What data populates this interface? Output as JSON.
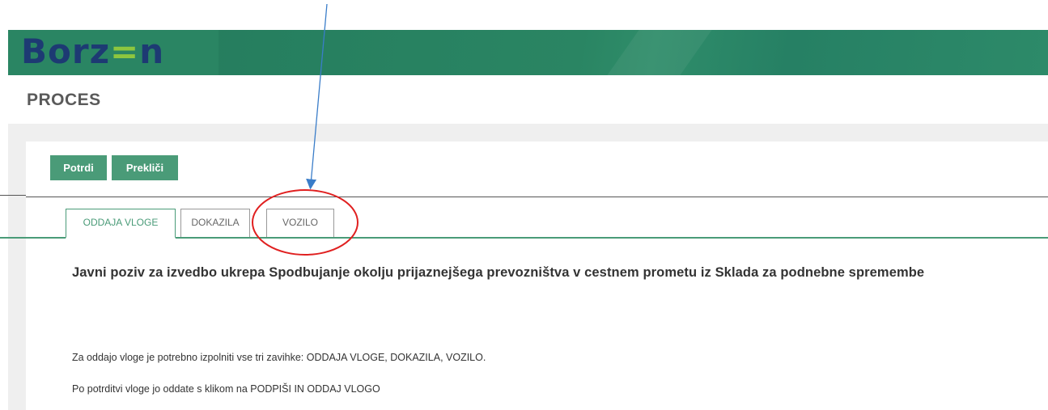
{
  "header": {
    "logo_text_part1": "Borz",
    "logo_text_accent": "=",
    "logo_text_part2": "n"
  },
  "page": {
    "title": "PROCES"
  },
  "toolbar": {
    "confirm_label": "Potrdi",
    "cancel_label": "Prekliči"
  },
  "tabs": [
    {
      "label": "ODDAJA VLOGE",
      "active": true
    },
    {
      "label": "DOKAZILA",
      "active": false
    },
    {
      "label": "VOZILO",
      "active": false
    }
  ],
  "content": {
    "heading": "Javni poziv za izvedbo ukrepa Spodbujanje okolju prijaznejšega prevozništva v cestnem prometu iz Sklada za podnebne spremembe",
    "paragraphs": [
      "Za oddajo vloge je potrebno izpolniti vse tri zavihke: ODDAJA VLOGE, DOKAZILA, VOZILO.",
      "Po potrditvi vloge jo oddate s klikom na PODPIŠI IN ODDAJ VLOGO"
    ]
  },
  "colors": {
    "brand_green": "#2a8563",
    "button_green": "#4a9b78",
    "logo_blue": "#1d3a73",
    "logo_accent": "#8dc63f",
    "annotation_red": "#e02020",
    "annotation_arrow": "#3a7dc9"
  }
}
